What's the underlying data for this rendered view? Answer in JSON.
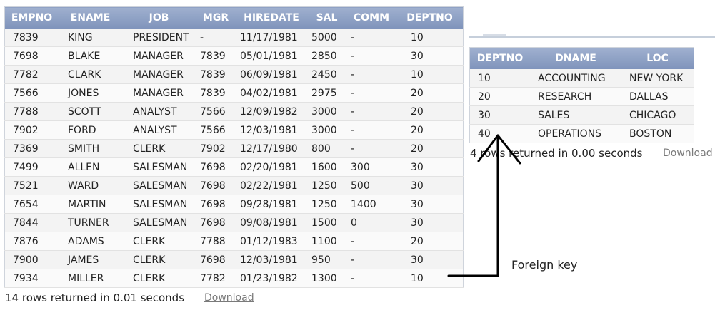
{
  "emp": {
    "columns": [
      "EMPNO",
      "ENAME",
      "JOB",
      "MGR",
      "HIREDATE",
      "SAL",
      "COMM",
      "DEPTNO"
    ],
    "rows": [
      [
        "7839",
        "KING",
        "PRESIDENT",
        "-",
        "11/17/1981",
        "5000",
        "-",
        "10"
      ],
      [
        "7698",
        "BLAKE",
        "MANAGER",
        "7839",
        "05/01/1981",
        "2850",
        "-",
        "30"
      ],
      [
        "7782",
        "CLARK",
        "MANAGER",
        "7839",
        "06/09/1981",
        "2450",
        "-",
        "10"
      ],
      [
        "7566",
        "JONES",
        "MANAGER",
        "7839",
        "04/02/1981",
        "2975",
        "-",
        "20"
      ],
      [
        "7788",
        "SCOTT",
        "ANALYST",
        "7566",
        "12/09/1982",
        "3000",
        "-",
        "20"
      ],
      [
        "7902",
        "FORD",
        "ANALYST",
        "7566",
        "12/03/1981",
        "3000",
        "-",
        "20"
      ],
      [
        "7369",
        "SMITH",
        "CLERK",
        "7902",
        "12/17/1980",
        "800",
        "-",
        "20"
      ],
      [
        "7499",
        "ALLEN",
        "SALESMAN",
        "7698",
        "02/20/1981",
        "1600",
        "300",
        "30"
      ],
      [
        "7521",
        "WARD",
        "SALESMAN",
        "7698",
        "02/22/1981",
        "1250",
        "500",
        "30"
      ],
      [
        "7654",
        "MARTIN",
        "SALESMAN",
        "7698",
        "09/28/1981",
        "1250",
        "1400",
        "30"
      ],
      [
        "7844",
        "TURNER",
        "SALESMAN",
        "7698",
        "09/08/1981",
        "1500",
        "0",
        "30"
      ],
      [
        "7876",
        "ADAMS",
        "CLERK",
        "7788",
        "01/12/1983",
        "1100",
        "-",
        "20"
      ],
      [
        "7900",
        "JAMES",
        "CLERK",
        "7698",
        "12/03/1981",
        "950",
        "-",
        "30"
      ],
      [
        "7934",
        "MILLER",
        "CLERK",
        "7782",
        "01/23/1982",
        "1300",
        "-",
        "10"
      ]
    ],
    "status": "14 rows returned in 0.01 seconds",
    "download_label": "Download"
  },
  "dept": {
    "columns": [
      "DEPTNO",
      "DNAME",
      "LOC"
    ],
    "rows": [
      [
        "10",
        "ACCOUNTING",
        "NEW YORK"
      ],
      [
        "20",
        "RESEARCH",
        "DALLAS"
      ],
      [
        "30",
        "SALES",
        "CHICAGO"
      ],
      [
        "40",
        "OPERATIONS",
        "BOSTON"
      ]
    ],
    "status": "4 rows returned in 0.00 seconds",
    "download_label": "Download"
  },
  "annotation": {
    "label": "Foreign key",
    "color": "#000000"
  },
  "colors": {
    "header_bg": "#8a9cc3",
    "header_text": "#ffffff",
    "row_odd": "#f3f3f3",
    "row_even": "#fafafa",
    "link": "#7a7a7a"
  }
}
